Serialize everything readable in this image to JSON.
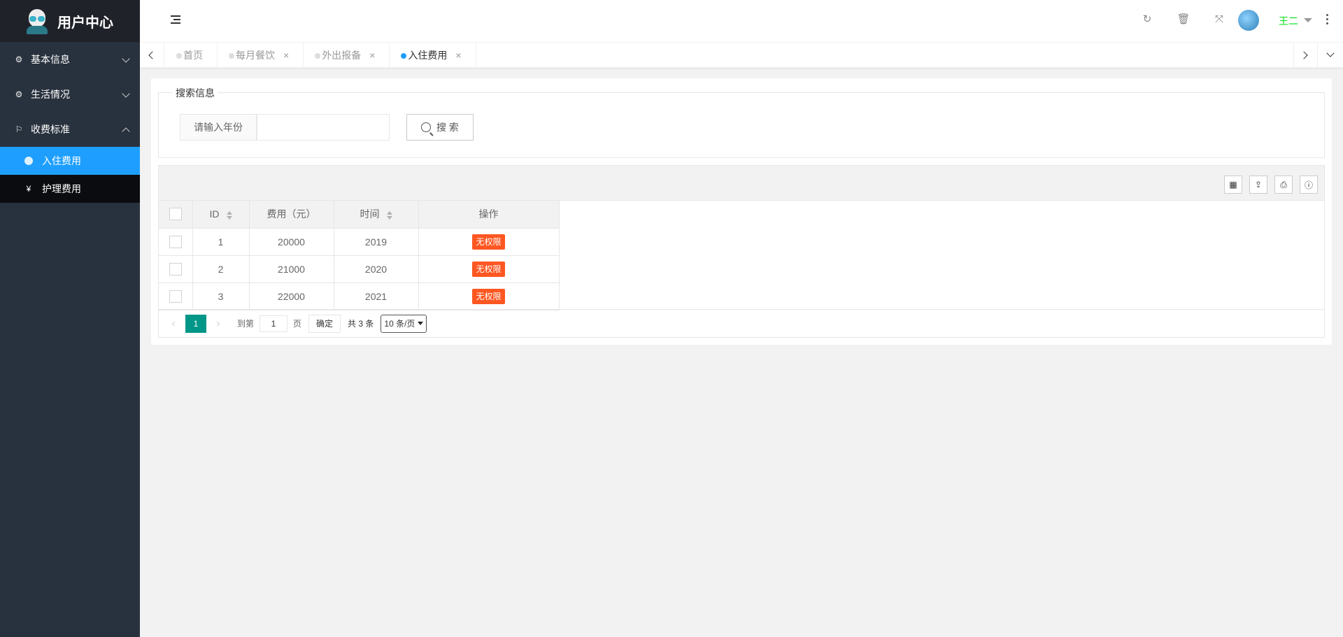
{
  "brand": {
    "title": "用户中心"
  },
  "sidebar": {
    "items": [
      {
        "label": "基本信息",
        "icon": "gears-icon",
        "expanded": false
      },
      {
        "label": "生活情况",
        "icon": "gears-icon",
        "expanded": false
      },
      {
        "label": "收费标准",
        "icon": "flag-icon",
        "expanded": true
      }
    ],
    "subitems": [
      {
        "label": "入住费用",
        "icon": "dot-icon",
        "active": true
      },
      {
        "label": "护理费用",
        "icon": "yen-icon",
        "active": false
      }
    ]
  },
  "header": {
    "user_name": "王二",
    "icons": [
      "refresh-icon",
      "trash-icon",
      "fullscreen-icon",
      "more-icon"
    ]
  },
  "tabs": [
    {
      "label": "首页",
      "closable": false,
      "active": false
    },
    {
      "label": "每月餐饮",
      "closable": true,
      "active": false
    },
    {
      "label": "外出报备",
      "closable": true,
      "active": false
    },
    {
      "label": "入住费用",
      "closable": true,
      "active": true
    }
  ],
  "search": {
    "legend": "搜索信息",
    "label": "请输入年份",
    "value": "",
    "button_label": "搜 索"
  },
  "table": {
    "columns": [
      "ID",
      "费用（元）",
      "时间",
      "操作"
    ],
    "rows": [
      {
        "id": "1",
        "fee": "20000",
        "year": "2019",
        "action": "无权限"
      },
      {
        "id": "2",
        "fee": "21000",
        "year": "2020",
        "action": "无权限"
      },
      {
        "id": "3",
        "fee": "22000",
        "year": "2021",
        "action": "无权限"
      }
    ],
    "toolbar_icons": [
      "columns-icon",
      "export-icon",
      "print-icon",
      "info-icon"
    ]
  },
  "pager": {
    "current_page": "1",
    "goto_prefix": "到第",
    "goto_value": "1",
    "goto_suffix": "页",
    "confirm": "确定",
    "count": "共 3 条",
    "limit": "10 条/页"
  },
  "colors": {
    "sidebar_bg": "#28323e",
    "active_blue": "#1e9fff",
    "badge_orange": "#ff5722",
    "pager_green": "#009688",
    "username_green": "#01e017"
  }
}
